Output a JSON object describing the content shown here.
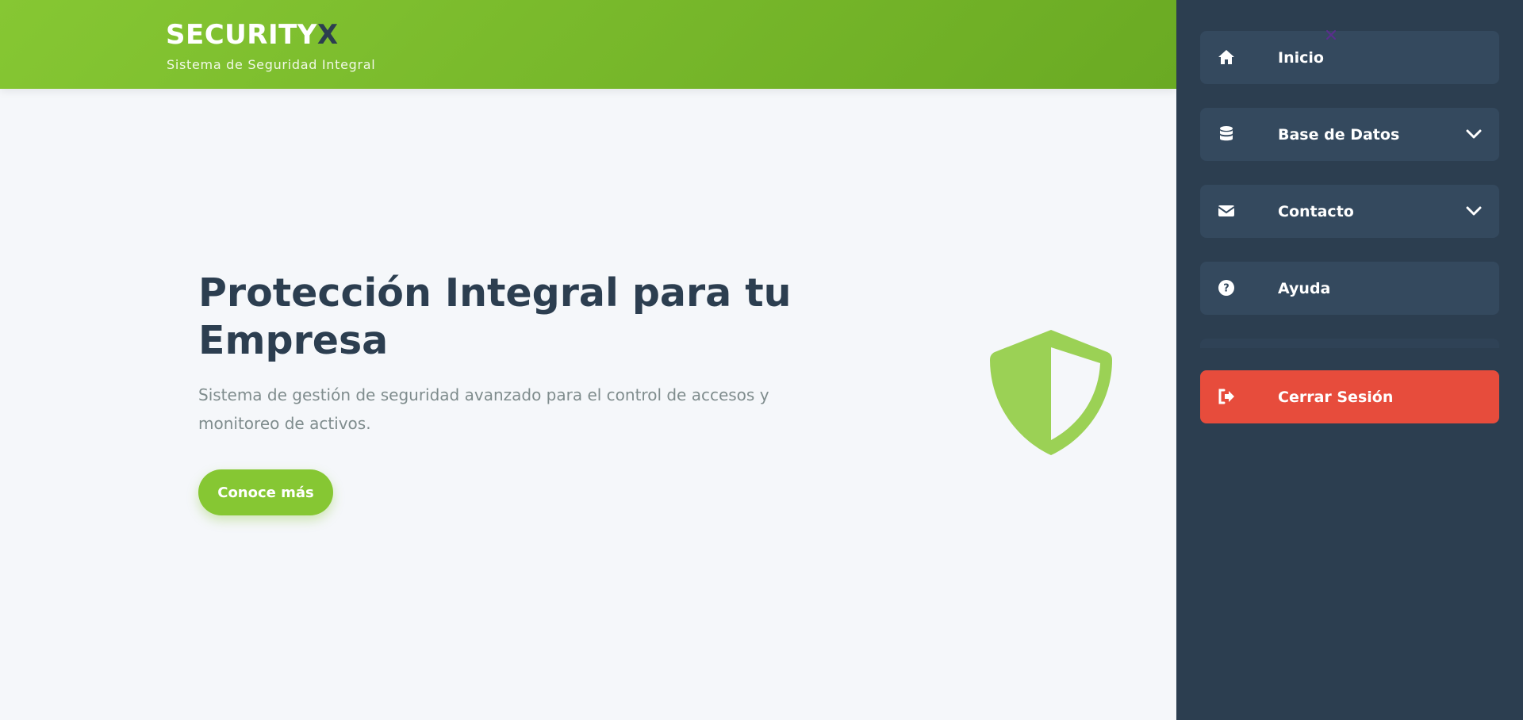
{
  "header": {
    "logo_main": "SECURITY",
    "logo_accent": "X",
    "tagline": "Sistema de Seguridad Integral"
  },
  "hero": {
    "title": "Protección Integral para tu Empresa",
    "description": "Sistema de gestión de seguridad avanzado para el control de accesos y monitoreo de activos.",
    "cta_label": "Conoce más"
  },
  "sidebar": {
    "items": [
      {
        "label": "Inicio",
        "icon": "home-icon"
      },
      {
        "label": "Base de Datos",
        "icon": "database-icon",
        "expandable": true
      },
      {
        "label": "Contacto",
        "icon": "envelope-icon",
        "expandable": true
      },
      {
        "label": "Ayuda",
        "icon": "question-circle-icon"
      }
    ],
    "logout_label": "Cerrar Sesión"
  },
  "colors": {
    "brand_green": "#86c733",
    "dark_navy": "#2c3e50",
    "sidebar_item": "#34495e",
    "danger": "#e74c3c",
    "shield": "#9bd155"
  }
}
